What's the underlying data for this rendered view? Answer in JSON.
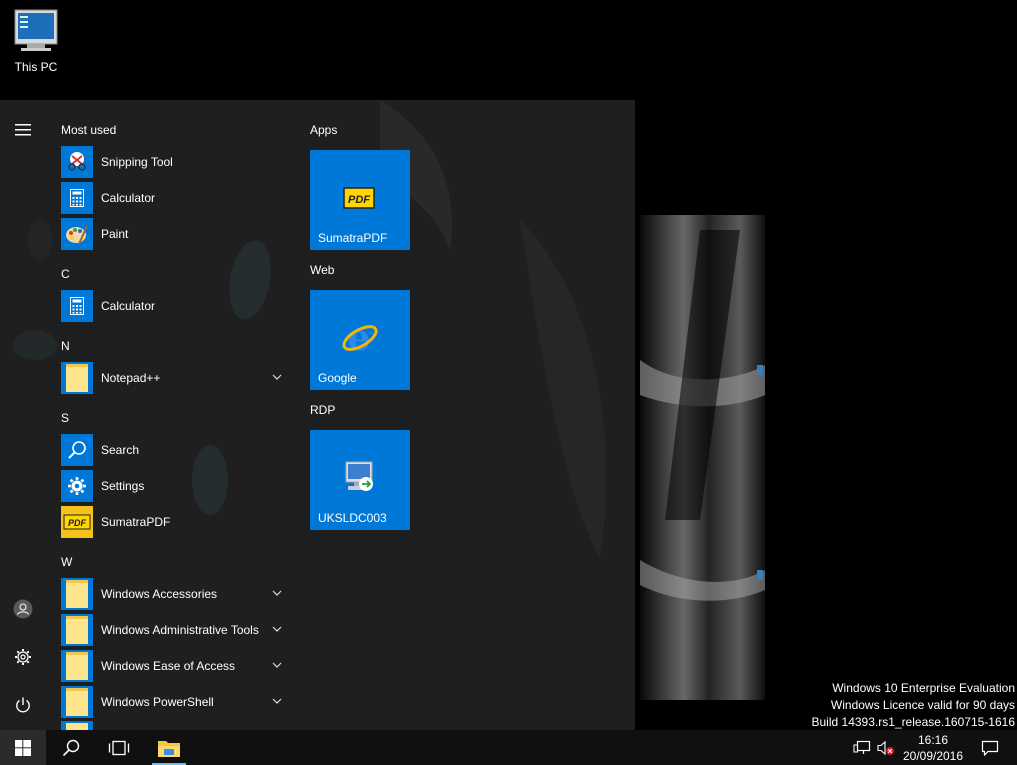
{
  "desktop": {
    "icons": [
      {
        "label": "This PC",
        "icon": "computer-icon"
      }
    ],
    "watermark": {
      "line1": "Windows 10 Enterprise Evaluation",
      "line2": "Windows Licence valid for 90 days",
      "line3": "Build 14393.rs1_release.160715-1616"
    }
  },
  "start_menu": {
    "rail": {
      "menu_icon": "hamburger-icon",
      "user_icon": "user-icon",
      "settings_icon": "gear-icon",
      "power_icon": "power-icon"
    },
    "most_used_title": "Most used",
    "most_used": [
      {
        "label": "Snipping Tool",
        "icon": "scissors-icon"
      },
      {
        "label": "Calculator",
        "icon": "calculator-icon"
      },
      {
        "label": "Paint",
        "icon": "palette-icon"
      }
    ],
    "sections": [
      {
        "letter": "C",
        "items": [
          {
            "label": "Calculator",
            "icon": "calculator-icon",
            "expandable": false
          }
        ]
      },
      {
        "letter": "N",
        "items": [
          {
            "label": "Notepad++",
            "icon": "folder-icon",
            "expandable": true
          }
        ]
      },
      {
        "letter": "S",
        "items": [
          {
            "label": "Search",
            "icon": "search-icon",
            "expandable": false
          },
          {
            "label": "Settings",
            "icon": "gear-icon",
            "expandable": false
          },
          {
            "label": "SumatraPDF",
            "icon": "pdf-icon",
            "expandable": false
          }
        ]
      },
      {
        "letter": "W",
        "items": [
          {
            "label": "Windows Accessories",
            "icon": "folder-icon",
            "expandable": true
          },
          {
            "label": "Windows Administrative Tools",
            "icon": "folder-icon",
            "expandable": true
          },
          {
            "label": "Windows Ease of Access",
            "icon": "folder-icon",
            "expandable": true
          },
          {
            "label": "Windows PowerShell",
            "icon": "folder-icon",
            "expandable": true
          }
        ]
      }
    ],
    "tile_groups": [
      {
        "title": "Apps",
        "tile": {
          "label": "SumatraPDF",
          "icon": "pdf-icon"
        }
      },
      {
        "title": "Web",
        "tile": {
          "label": "Google",
          "icon": "internet-explorer-icon"
        }
      },
      {
        "title": "RDP",
        "tile": {
          "label": "UKSLDC003",
          "icon": "remote-desktop-icon"
        }
      }
    ]
  },
  "taskbar": {
    "start_icon": "windows-logo-icon",
    "search_icon": "search-icon",
    "task_view_icon": "task-view-icon",
    "pinned": [
      {
        "icon": "file-explorer-icon",
        "active": true
      }
    ],
    "tray": {
      "network_icon": "network-icon",
      "volume_icon": "volume-muted-icon"
    },
    "clock_time": "16:16",
    "clock_date": "20/09/2016",
    "notifications_icon": "action-center-icon"
  },
  "colors": {
    "accent": "#0078d7",
    "menu_bg": "#1f1f1f",
    "taskbar_bg": "#101010",
    "folder": "#fde58d"
  }
}
